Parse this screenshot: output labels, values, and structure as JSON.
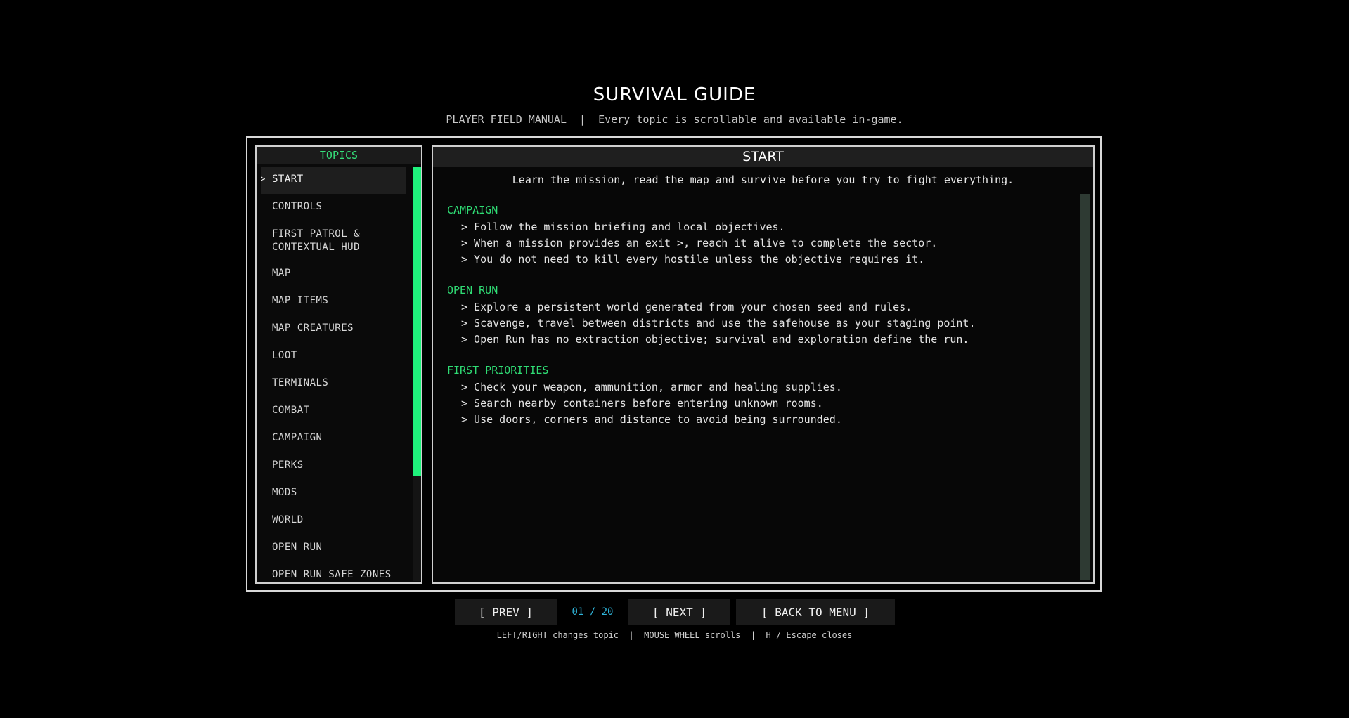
{
  "title": "SURVIVAL GUIDE",
  "subtitle": "PLAYER FIELD MANUAL  |  Every topic is scrollable and available in-game.",
  "topics_panel": {
    "header": "TOPICS",
    "items": [
      {
        "label": "START",
        "active": true,
        "marker": ">"
      },
      {
        "label": "CONTROLS"
      },
      {
        "label": "FIRST PATROL & CONTEXTUAL HUD"
      },
      {
        "label": "MAP"
      },
      {
        "label": "MAP ITEMS"
      },
      {
        "label": "MAP CREATURES"
      },
      {
        "label": "LOOT"
      },
      {
        "label": "TERMINALS"
      },
      {
        "label": "COMBAT"
      },
      {
        "label": "CAMPAIGN"
      },
      {
        "label": "PERKS"
      },
      {
        "label": "MODS"
      },
      {
        "label": "WORLD"
      },
      {
        "label": "OPEN RUN"
      },
      {
        "label": "OPEN RUN SAFE ZONES"
      }
    ]
  },
  "content": {
    "header": "START",
    "intro": "Learn the mission, read the map and survive before you try to fight everything.",
    "sections": [
      {
        "title": "CAMPAIGN",
        "bullets": [
          "> Follow the mission briefing and local objectives.",
          "> When a mission provides an exit >, reach it alive to complete the sector.",
          "> You do not need to kill every hostile unless the objective requires it."
        ]
      },
      {
        "title": "OPEN RUN",
        "bullets": [
          "> Explore a persistent world generated from your chosen seed and rules.",
          "> Scavenge, travel between districts and use the safehouse as your staging point.",
          "> Open Run has no extraction objective; survival and exploration define the run."
        ]
      },
      {
        "title": "FIRST PRIORITIES",
        "bullets": [
          "> Check your weapon, ammunition, armor and healing supplies.",
          "> Search nearby containers before entering unknown rooms.",
          "> Use doors, corners and distance to avoid being surrounded."
        ]
      }
    ]
  },
  "nav": {
    "prev_label": "[ PREV ]",
    "page_counter": "01 / 20",
    "next_label": "[ NEXT ]",
    "back_label": "[ BACK TO MENU ]"
  },
  "hints": "LEFT/RIGHT changes topic  |  MOUSE WHEEL scrolls  |  H / Escape closes",
  "colors": {
    "accent_green": "#2fdc74",
    "scroll_thumb": "#1ff27c",
    "counter_blue": "#2fb4d9"
  }
}
